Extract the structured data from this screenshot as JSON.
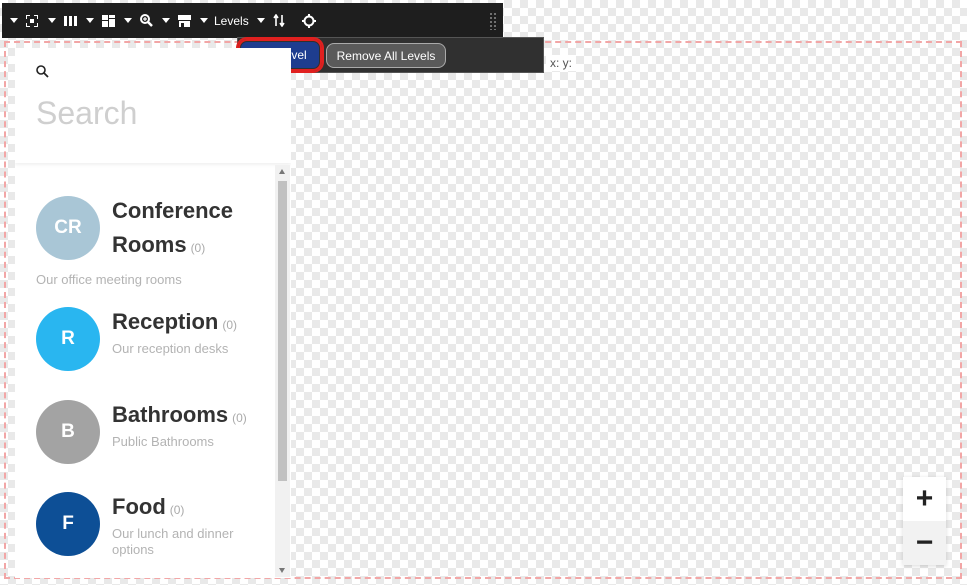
{
  "toolbar": {
    "levels_label": "Levels",
    "icons": [
      "fullscreen-icon",
      "columns-icon",
      "layout-icon",
      "zoom-icon",
      "store-icon",
      "sort-icon",
      "target-icon"
    ]
  },
  "levels_menu": {
    "add_level": "Add Level",
    "remove_all_levels": "Remove All Levels"
  },
  "coords": {
    "label": "x: y:"
  },
  "search": {
    "placeholder": "Search"
  },
  "categories": [
    {
      "initials": "CR",
      "title_line1": "Conference",
      "title_line2": "Rooms",
      "count": "(0)",
      "description": "Our office meeting rooms",
      "color": "#a9c6d6"
    },
    {
      "initials": "R",
      "title": "Reception",
      "count": "(0)",
      "description": "Our reception desks",
      "color": "#29b6f0"
    },
    {
      "initials": "B",
      "title": "Bathrooms",
      "count": "(0)",
      "description": "Public Bathrooms",
      "color": "#a3a3a3"
    },
    {
      "initials": "F",
      "title": "Food",
      "count": "(0)",
      "description_line1": "Our lunch and dinner",
      "description_line2": "options",
      "color": "#0d4f96"
    }
  ],
  "zoom": {
    "in": "+",
    "out": "−"
  },
  "colors": {
    "toolbar_bg": "#1e1e1e",
    "add_level_bg": "#1e3d8f",
    "highlight": "#e0201f"
  }
}
